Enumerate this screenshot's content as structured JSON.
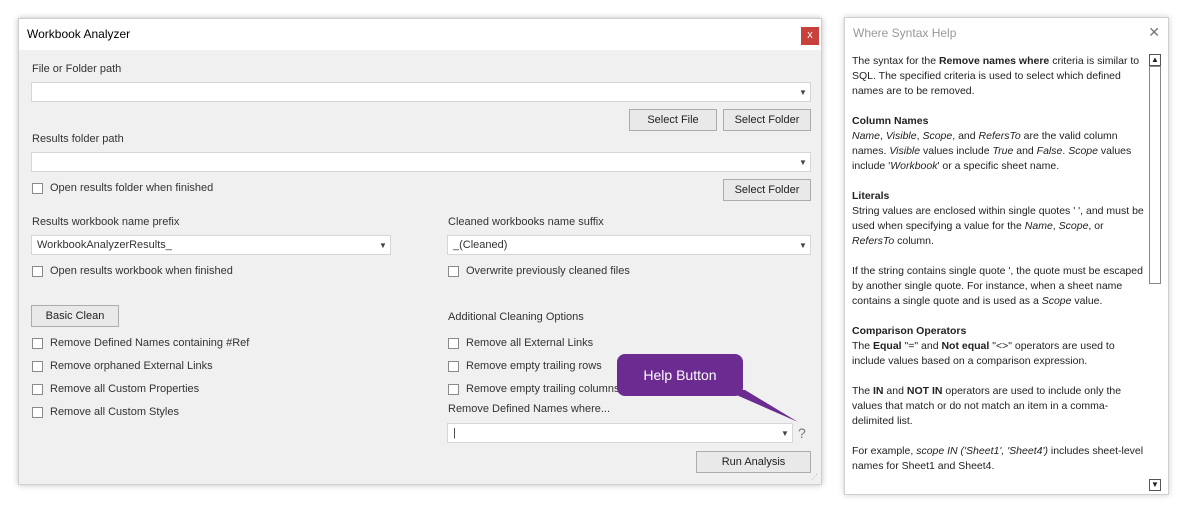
{
  "dialog": {
    "title": "Workbook Analyzer",
    "close_label": "x",
    "file_path": {
      "label": "File or Folder path",
      "value": ""
    },
    "select_file_label": "Select File",
    "select_folder_label": "Select Folder",
    "results_path": {
      "label": "Results folder path",
      "value": ""
    },
    "open_results_folder_label": "Open results folder when finished",
    "select_folder2_label": "Select Folder",
    "prefix": {
      "label": "Results workbook name prefix",
      "value": "WorkbookAnalyzerResults_"
    },
    "suffix": {
      "label": "Cleaned workbooks name suffix",
      "value": "_(Cleaned)"
    },
    "open_results_workbook_label": "Open results workbook when finished",
    "overwrite_label": "Overwrite previously cleaned files",
    "basic_clean_label": "Basic Clean",
    "additional_label": "Additional Cleaning Options",
    "basic_options": [
      "Remove Defined Names containing #Ref",
      "Remove orphaned External Links",
      "Remove all Custom Properties",
      "Remove all Custom Styles"
    ],
    "additional_options": [
      "Remove all External Links",
      "Remove empty trailing rows",
      "Remove empty trailing columns"
    ],
    "remove_where": {
      "label": "Remove Defined Names where...",
      "value": "|"
    },
    "help_q": "?",
    "run_label": "Run Analysis"
  },
  "callout": {
    "text": "Help Button",
    "color": "#6b2b90"
  },
  "help": {
    "title": "Where Syntax Help",
    "close_label": "✕"
  }
}
